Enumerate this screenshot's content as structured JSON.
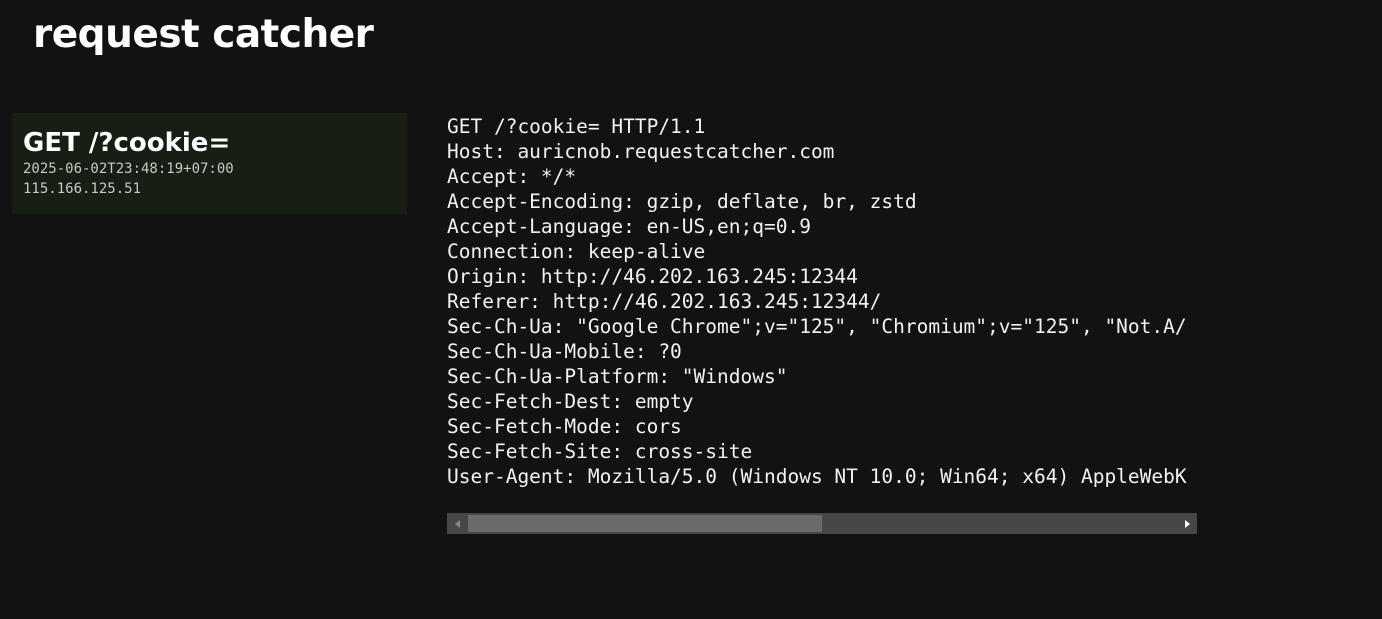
{
  "app": {
    "title": "request catcher"
  },
  "requests": [
    {
      "summary": "GET /?cookie=",
      "timestamp": "2025-06-02T23:48:19+07:00",
      "ip": "115.166.125.51"
    }
  ],
  "detail": {
    "lines": [
      "GET /?cookie= HTTP/1.1",
      "Host: auricnob.requestcatcher.com",
      "Accept: */*",
      "Accept-Encoding: gzip, deflate, br, zstd",
      "Accept-Language: en-US,en;q=0.9",
      "Connection: keep-alive",
      "Origin: http://46.202.163.245:12344",
      "Referer: http://46.202.163.245:12344/",
      "Sec-Ch-Ua: \"Google Chrome\";v=\"125\", \"Chromium\";v=\"125\", \"Not.A/",
      "Sec-Ch-Ua-Mobile: ?0",
      "Sec-Ch-Ua-Platform: \"Windows\"",
      "Sec-Fetch-Dest: empty",
      "Sec-Fetch-Mode: cors",
      "Sec-Fetch-Site: cross-site",
      "User-Agent: Mozilla/5.0 (Windows NT 10.0; Win64; x64) AppleWebK"
    ]
  },
  "scrollbar": {
    "position_fraction": 0.0,
    "visible_fraction": 0.5
  },
  "colors": {
    "background": "#121212",
    "card_background": "#171f15",
    "scrollbar_track": "#474747",
    "scrollbar_thumb": "#6b6b6b"
  }
}
